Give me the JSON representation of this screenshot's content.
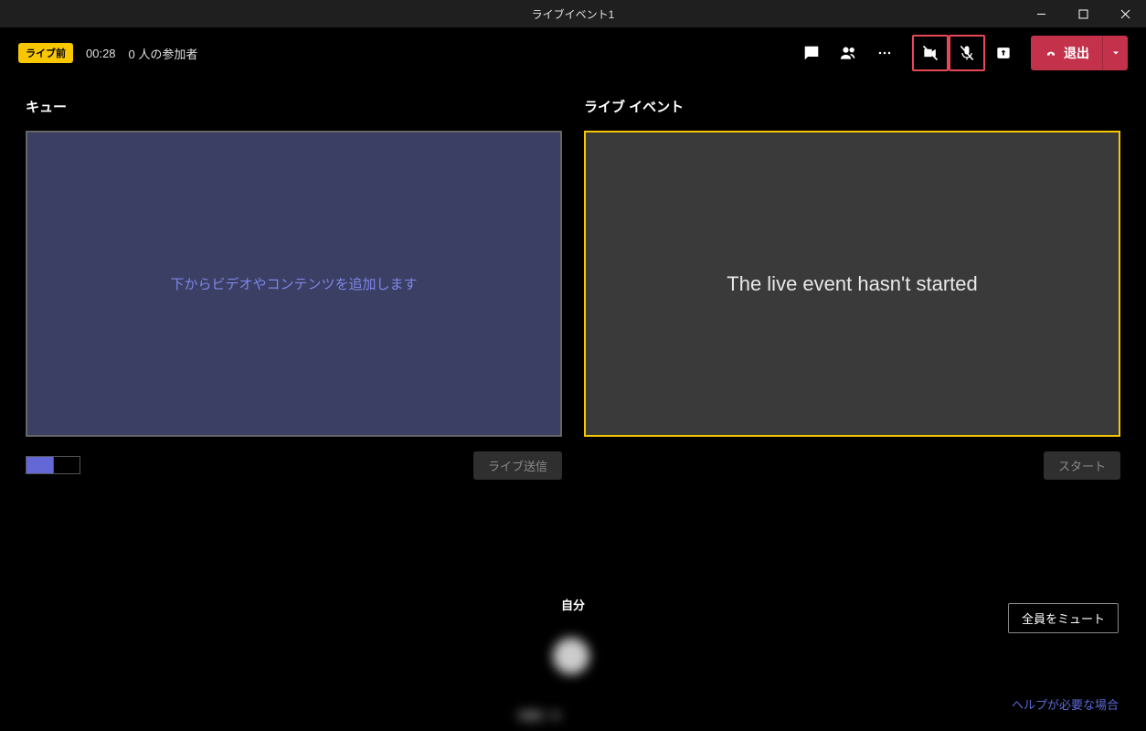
{
  "window": {
    "title": "ライブイベント1"
  },
  "toolbar": {
    "badge": "ライブ前",
    "timer": "00:28",
    "participants": "0 人の参加者",
    "leave_label": "退出"
  },
  "queue": {
    "title": "キュー",
    "message": "下からビデオやコンテンツを追加します",
    "send_button": "ライブ送信"
  },
  "live": {
    "title": "ライブ イベント",
    "message": "The live event hasn't started",
    "start_button": "スタート"
  },
  "bottom": {
    "self_label": "自分",
    "mute_all": "全員をミュート",
    "help": "ヘルプが必要な場合"
  }
}
